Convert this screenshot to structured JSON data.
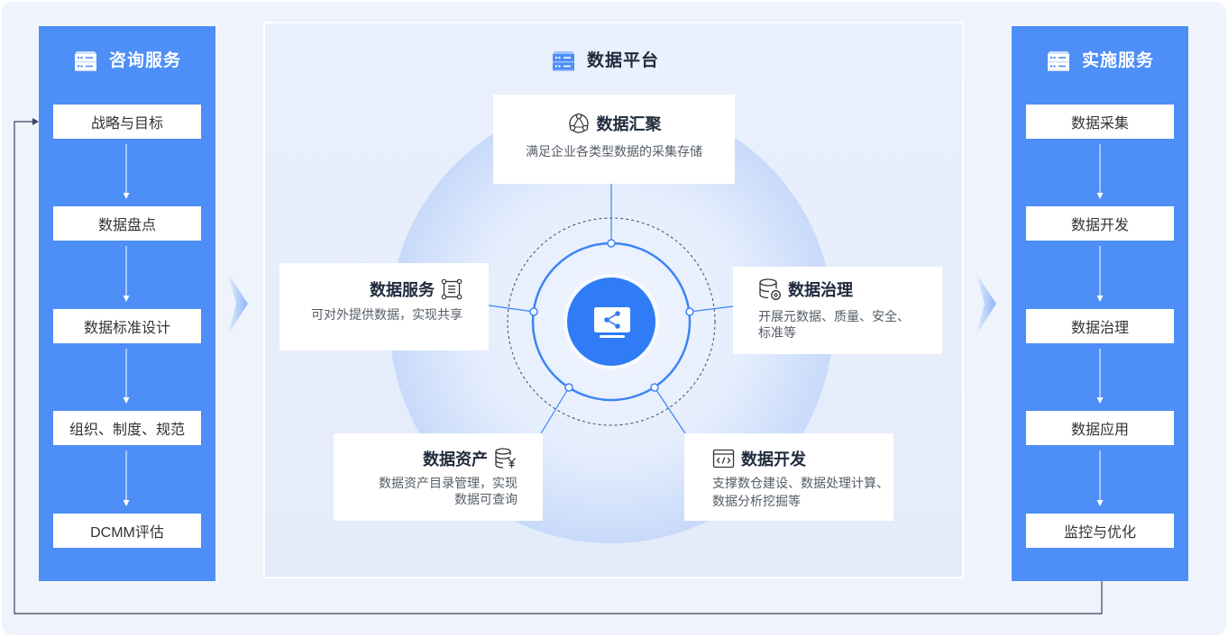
{
  "colors": {
    "page_background": "#eef3fc",
    "side_panel_blue": "#4d8ef7",
    "platform_background": "#e4ebfa",
    "ring_blue": "#3b84f5",
    "hub_blue": "#2f7cf6",
    "loop_line": "#3a4660",
    "title_text": "#1f2a3d",
    "body_text": "#333333",
    "muted_text": "#555c66"
  },
  "consulting_panel": {
    "title": "咨询服务",
    "icon": "server-icon",
    "step_arrow_icon": "arrow-down-icon",
    "steps": [
      "战略与目标",
      "数据盘点",
      "数据标准设计",
      "组织、制度、规范",
      "DCMM评估"
    ]
  },
  "platform_panel": {
    "title": "数据平台",
    "icon": "server-icon",
    "hub_icon": "monitor-share-icon",
    "modules": [
      {
        "title": "数据汇聚",
        "icon": "network-hub-icon",
        "desc_lines": [
          "满足企业各类型数据的采集存储"
        ]
      },
      {
        "title": "数据服务",
        "icon": "list-frame-icon",
        "desc_lines": [
          "可对外提供数据，实现共享"
        ]
      },
      {
        "title": "数据治理",
        "icon": "database-settings-icon",
        "desc_lines": [
          "开展元数据、质量、安全、",
          "标准等"
        ]
      },
      {
        "title": "数据资产",
        "icon": "database-yen-icon",
        "desc_lines": [
          "数据资产目录管理，实现",
          "数据可查询"
        ]
      },
      {
        "title": "数据开发",
        "icon": "code-window-icon",
        "desc_lines": [
          "支撑数仓建设、数据处理计算、",
          "数据分析挖掘等"
        ]
      }
    ]
  },
  "implementation_panel": {
    "title": "实施服务",
    "icon": "server-icon",
    "step_arrow_icon": "arrow-down-icon",
    "steps": [
      "数据采集",
      "数据开发",
      "数据治理",
      "数据应用",
      "监控与优化"
    ]
  },
  "flow": {
    "between_panels_icon": "chevron-right-icon",
    "loop_icon": "loop-back-arrow-icon"
  }
}
